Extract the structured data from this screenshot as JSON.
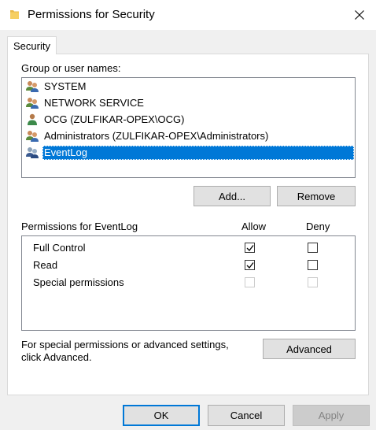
{
  "window": {
    "title": "Permissions for Security",
    "close_icon": "close-icon"
  },
  "tab": {
    "label": "Security"
  },
  "group_label": "Group or user names:",
  "users": [
    {
      "name": "SYSTEM",
      "icon": "group-icon",
      "selected": false
    },
    {
      "name": "NETWORK SERVICE",
      "icon": "group-icon",
      "selected": false
    },
    {
      "name": "OCG (ZULFIKAR-OPEX\\OCG)",
      "icon": "user-icon",
      "selected": false
    },
    {
      "name": "Administrators (ZULFIKAR-OPEX\\Administrators)",
      "icon": "group-icon",
      "selected": false
    },
    {
      "name": "EventLog",
      "icon": "group-icon",
      "selected": true
    }
  ],
  "buttons": {
    "add": "Add...",
    "remove": "Remove",
    "advanced": "Advanced",
    "ok": "OK",
    "cancel": "Cancel",
    "apply": "Apply"
  },
  "permissions": {
    "header": "Permissions for EventLog",
    "allow_header": "Allow",
    "deny_header": "Deny",
    "rows": [
      {
        "label": "Full Control",
        "allow": true,
        "deny": false,
        "enabled": true
      },
      {
        "label": "Read",
        "allow": true,
        "deny": false,
        "enabled": true
      },
      {
        "label": "Special permissions",
        "allow": false,
        "deny": false,
        "enabled": false
      }
    ]
  },
  "advanced_hint": {
    "line1": "For special permissions or advanced settings,",
    "line2": "click Advanced."
  },
  "colors": {
    "selection": "#0078d7",
    "dialog_bg": "#f0f0f0",
    "default_button_border": "#0078d7"
  }
}
